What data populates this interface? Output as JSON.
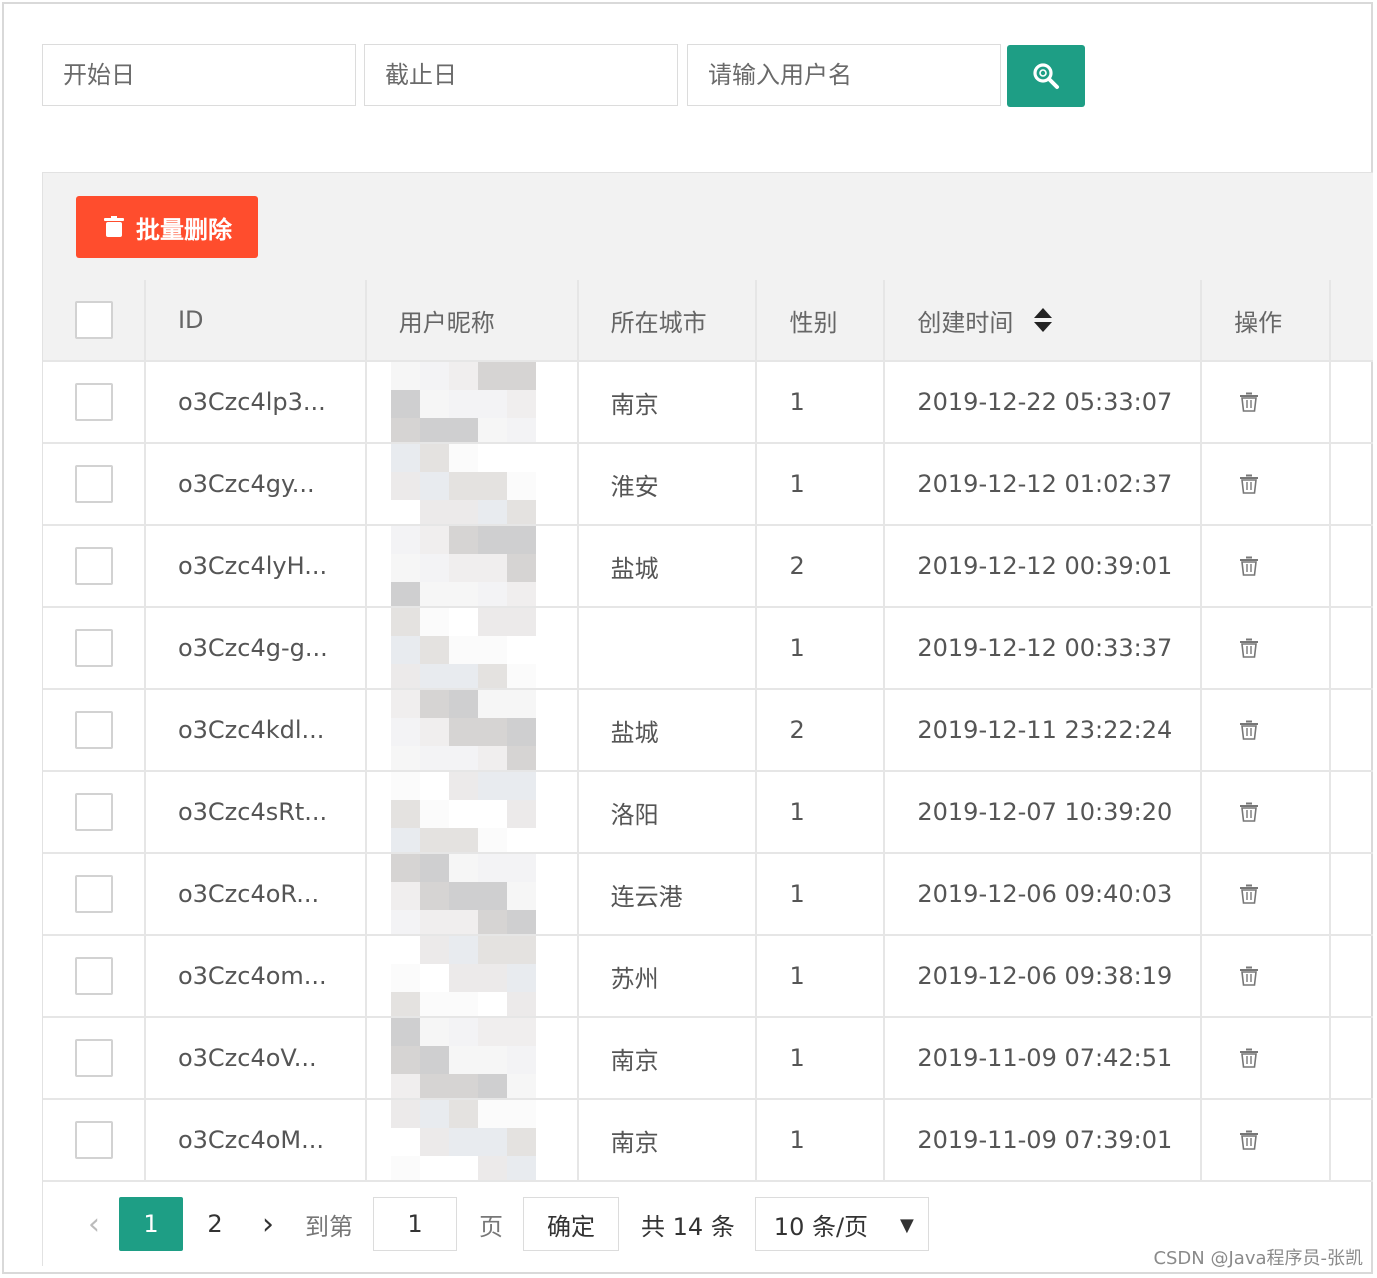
{
  "search": {
    "start_date_placeholder": "开始日",
    "end_date_placeholder": "截止日",
    "username_placeholder": "请输入用户名"
  },
  "toolbar": {
    "batch_delete_label": "批量删除"
  },
  "table": {
    "columns": [
      "ID",
      "用户昵称",
      "所在城市",
      "性别",
      "创建时间",
      "操作"
    ],
    "rows": [
      {
        "id": "o3Czc4lp3...",
        "city": "南京",
        "gender": "1",
        "created": "2019-12-22 05:33:07"
      },
      {
        "id": "o3Czc4gy...",
        "city": "淮安",
        "gender": "1",
        "created": "2019-12-12 01:02:37"
      },
      {
        "id": "o3Czc4lyH...",
        "city": "盐城",
        "gender": "2",
        "created": "2019-12-12 00:39:01"
      },
      {
        "id": "o3Czc4g-g...",
        "city": "",
        "gender": "1",
        "created": "2019-12-12 00:33:37"
      },
      {
        "id": "o3Czc4kdl...",
        "city": "盐城",
        "gender": "2",
        "created": "2019-12-11 23:22:24"
      },
      {
        "id": "o3Czc4sRt...",
        "city": "洛阳",
        "gender": "1",
        "created": "2019-12-07 10:39:20"
      },
      {
        "id": "o3Czc4oR...",
        "city": "连云港",
        "gender": "1",
        "created": "2019-12-06 09:40:03"
      },
      {
        "id": "o3Czc4om...",
        "city": "苏州",
        "gender": "1",
        "created": "2019-12-06 09:38:19"
      },
      {
        "id": "o3Czc4oV...",
        "city": "南京",
        "gender": "1",
        "created": "2019-11-09 07:42:51"
      },
      {
        "id": "o3Czc4oM...",
        "city": "南京",
        "gender": "1",
        "created": "2019-11-09 07:39:01"
      }
    ]
  },
  "pager": {
    "prev": "‹",
    "pages": [
      "1",
      "2"
    ],
    "current": "1",
    "next": "›",
    "goto_label": "到第",
    "goto_value": "1",
    "page_unit": "页",
    "confirm_label": "确定",
    "total_label": "共 14 条",
    "page_size": "10 条/页"
  },
  "watermark": "CSDN @Java程序员-张凯",
  "colors": {
    "accent": "#1e9e85",
    "danger": "#ff4d2d"
  }
}
